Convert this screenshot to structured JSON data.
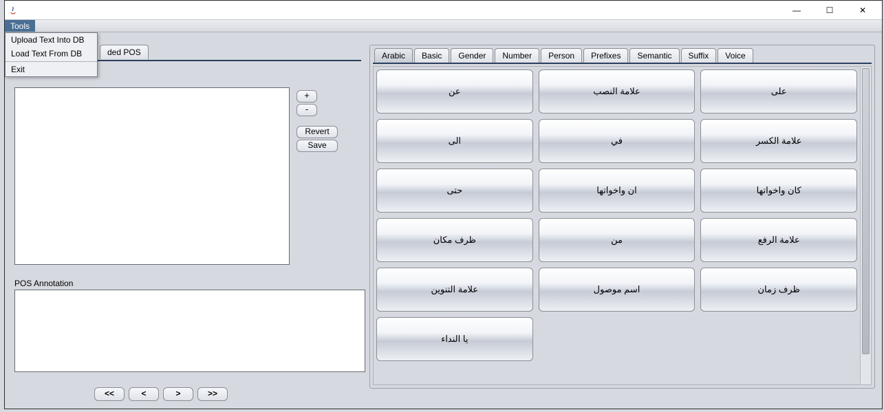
{
  "window": {
    "minimize": "—",
    "maximize": "☐",
    "close": "✕"
  },
  "menubar": {
    "tools": "Tools"
  },
  "tools_menu": {
    "upload": "Upload Text Into DB",
    "load": "Load Text From DB",
    "exit": "Exit"
  },
  "left": {
    "tab_partial": "ded POS",
    "plus": "+",
    "minus": "-",
    "revert": "Revert",
    "save": "Save",
    "pos_label": "POS Annotation",
    "nav_first": "<<",
    "nav_prev": "<",
    "nav_next": ">",
    "nav_last": ">>"
  },
  "right_tabs": [
    "Arabic",
    "Basic",
    "Gender",
    "Number",
    "Person",
    "Prefixes",
    "Semantic",
    "Suffix",
    "Voice"
  ],
  "pos_buttons": [
    "عن",
    "علامة النصب",
    "على",
    "الى",
    "في",
    "علامة الكسر",
    "حتى",
    "ان واخواتها",
    "كان واخواتها",
    "ظرف مكان",
    "من",
    "علامة الرفع",
    "علامة التنوين",
    "اسم موصول",
    "ظرف زمان",
    "يا النداء"
  ]
}
